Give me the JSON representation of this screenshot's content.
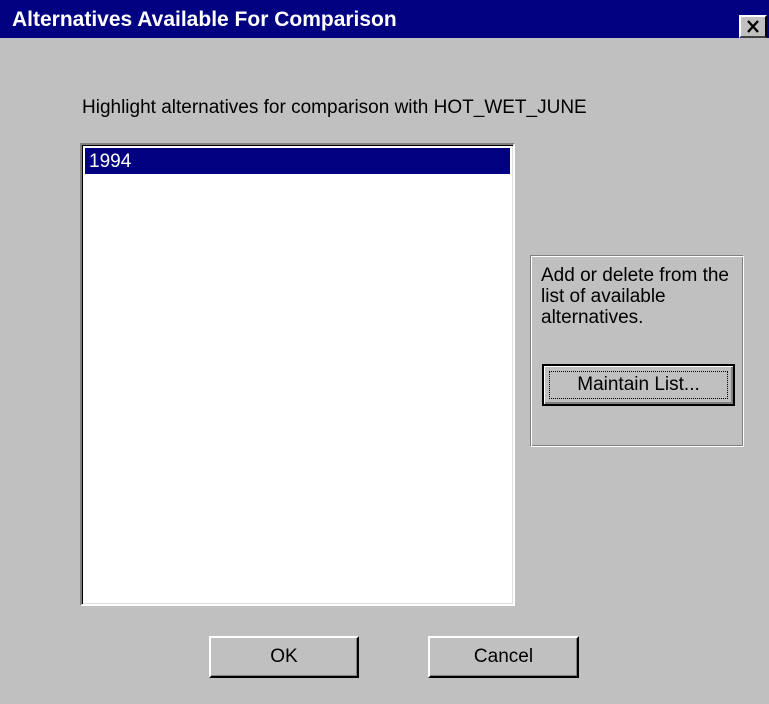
{
  "window": {
    "title": "Alternatives Available For Comparison",
    "close_icon": "close-icon"
  },
  "instruction": "Highlight alternatives for comparison with HOT_WET_JUNE",
  "alternatives_list": {
    "items": [
      {
        "label": "1994",
        "selected": true
      }
    ]
  },
  "maintain_group": {
    "description": "Add or delete from the list of available alternatives.",
    "button_label": "Maintain List..."
  },
  "footer": {
    "ok_label": "OK",
    "cancel_label": "Cancel"
  },
  "colors": {
    "titlebar": "#000080",
    "face": "#c0c0c0",
    "selection": "#000080"
  }
}
